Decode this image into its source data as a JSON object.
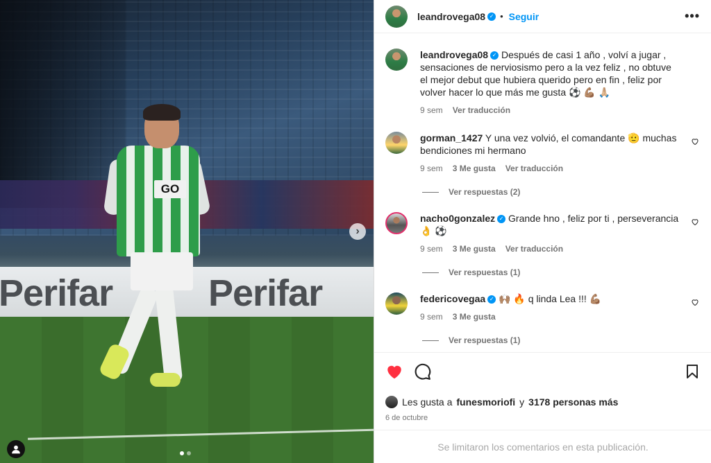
{
  "post": {
    "author": "leandrovega08",
    "follow_label": "Seguir",
    "more_label": "•••",
    "photo_sponsor_text": "GO",
    "photo_ad_text": "Perifar",
    "caption": {
      "username": "leandrovega08",
      "text": "Después de casi 1 año , volví a jugar , sensaciones de nerviosismo pero a la vez feliz , no obtuve el mejor debut que hubiera querido pero en fin , feliz por volver hacer lo que más me gusta ⚽ 💪🏽 🙏🏼",
      "time": "9 sem",
      "translate": "Ver traducción"
    },
    "comments": [
      {
        "username": "gorman_1427",
        "verified": false,
        "text": "Y una vez volvió, el comandante 🫡 muchas bendiciones mi hermano",
        "time": "9 sem",
        "likes": "3 Me gusta",
        "translate": "Ver traducción",
        "replies": "Ver respuestas (2)"
      },
      {
        "username": "nacho0gonzalez",
        "verified": true,
        "text": "Grande hno , feliz por ti , perseverancia 👌 ⚽",
        "time": "9 sem",
        "likes": "3 Me gusta",
        "translate": "Ver traducción",
        "replies": "Ver respuestas (1)"
      },
      {
        "username": "federicovegaa",
        "verified": true,
        "text": "🙌🏽 🔥 q linda Lea !!! 💪🏽",
        "time": "9 sem",
        "likes": "3 Me gusta",
        "translate": "",
        "replies": "Ver respuestas (1)"
      }
    ],
    "likes": {
      "prefix": "Les gusta a",
      "user": "funesmoriofi",
      "joiner": "y",
      "others": "3178 personas más"
    },
    "date": "6 de octubre",
    "comments_limited": "Se limitaron los comentarios en esta publicación.",
    "carousel": {
      "slides": 2,
      "current": 1
    },
    "colors": {
      "accent": "#0095f6",
      "like": "#ff3040",
      "muted": "#737373"
    },
    "icons": [
      "heart-icon",
      "comment-icon",
      "bookmark-icon",
      "chevron-right-icon",
      "user-tag-icon",
      "verified-icon",
      "more-icon"
    ]
  }
}
